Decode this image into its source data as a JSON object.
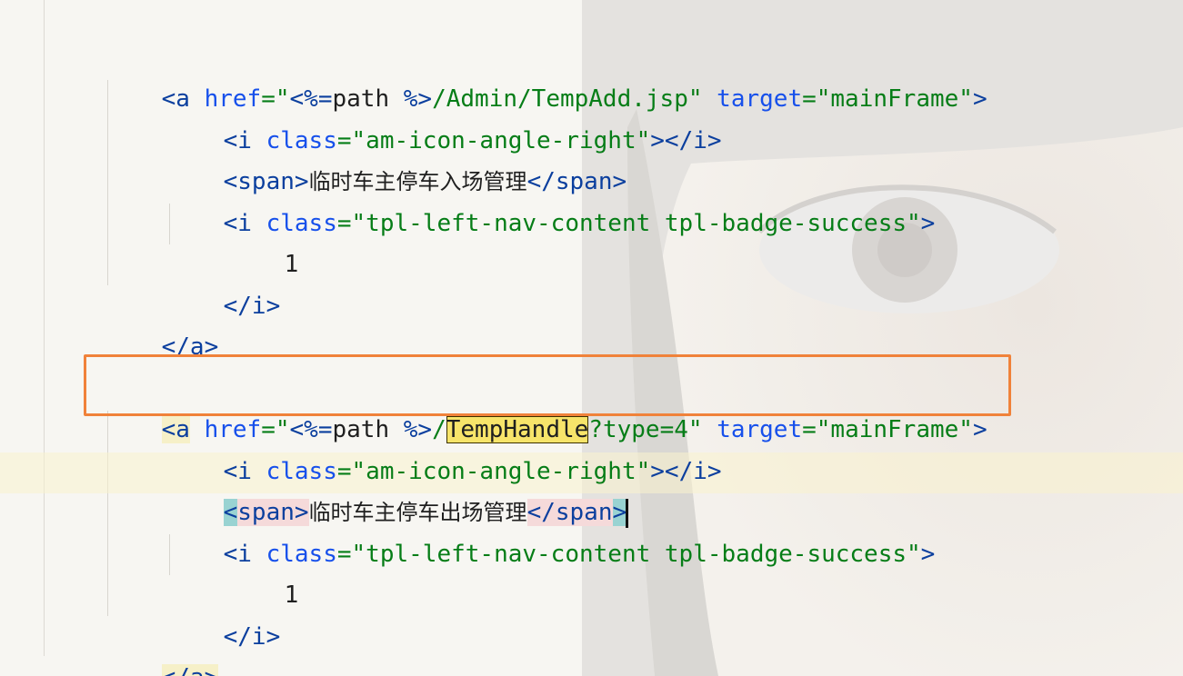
{
  "editor": {
    "language": "JSP",
    "colors": {
      "tag": "#0b3f9e",
      "attribute": "#1750eb",
      "string": "#067d17",
      "text": "#1f1f1f",
      "search_highlight": "#f7e46a",
      "annotation_box": "#f0823a"
    },
    "lines": [
      {
        "tag_open": "<a",
        "attr1": "href",
        "eq1": "=",
        "str1_open": "\"",
        "scriptlet_open": "<%=",
        "expr": "path ",
        "scriptlet_close": "%>",
        "path": "/Admin/TempAdd.jsp\"",
        "attr2": "target",
        "eq2": "=",
        "str2": "\"mainFrame\"",
        "tag_close": ">"
      },
      {
        "tag_open": "<i",
        "attr": "class",
        "eq": "=",
        "str": "\"am-icon-angle-right\"",
        "mid": ">",
        "end_tag": "</i",
        "close": ">"
      },
      {
        "open": "<",
        "tag": "span",
        "close": ">",
        "text": "临时车主停车入场管理",
        "end_open": "</",
        "end_tag": "span",
        "end_close": ">"
      },
      {
        "tag_open": "<i",
        "attr": "class",
        "eq": "=",
        "str": "\"tpl-left-nav-content tpl-badge-success\"",
        "close": ">"
      },
      {
        "text": "1"
      },
      {
        "end_tag": "</i",
        "close": ">"
      },
      {
        "end_tag": "</a",
        "close": ">"
      },
      {
        "tag_open": "<a",
        "attr1": "href",
        "eq1": "=",
        "str1_open": "\"",
        "scriptlet_open": "<%=",
        "expr": "path ",
        "scriptlet_close": "%>",
        "slash": "/",
        "search_hit": "TempHandle",
        "rest": "?type=4\"",
        "attr2": "target",
        "eq2": "=",
        "str2": "\"mainFrame\"",
        "tag_close": ">"
      },
      {
        "tag_open": "<i",
        "attr": "class",
        "eq": "=",
        "str": "\"am-icon-angle-right\"",
        "mid": ">",
        "end_tag": "</i",
        "close": ">"
      },
      {
        "open": "<",
        "tag": "span",
        "close": ">",
        "text": "临时车主停车出场管理",
        "end_open": "</",
        "end_tag": "span",
        "end_close": ">"
      },
      {
        "tag_open": "<i",
        "attr": "class",
        "eq": "=",
        "str": "\"tpl-left-nav-content tpl-badge-success\"",
        "close": ">"
      },
      {
        "text": "1"
      },
      {
        "end_tag": "</i",
        "close": ">"
      },
      {
        "end_tag": "</a",
        "close": ">"
      }
    ]
  }
}
